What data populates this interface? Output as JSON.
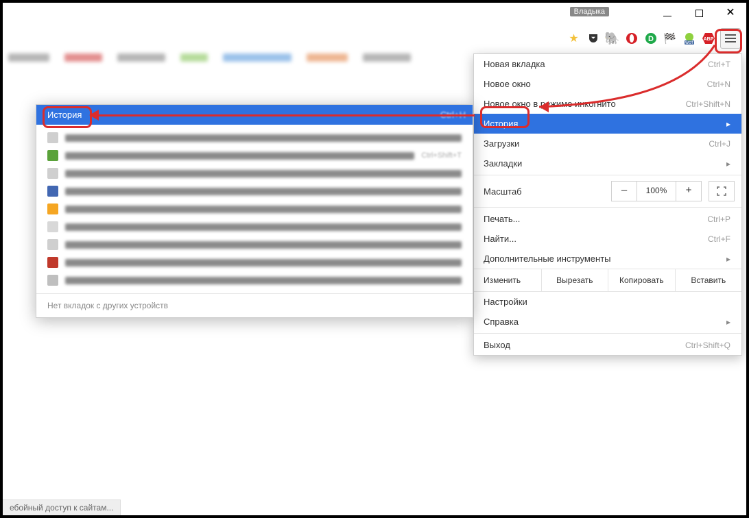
{
  "window": {
    "user_badge": "Владыка"
  },
  "menu": {
    "new_tab": {
      "label": "Новая вкладка",
      "shortcut": "Ctrl+T"
    },
    "new_window": {
      "label": "Новое окно",
      "shortcut": "Ctrl+N"
    },
    "incognito": {
      "label": "Новое окно в режиме инкогнито",
      "shortcut": "Ctrl+Shift+N"
    },
    "history": {
      "label": "История"
    },
    "downloads": {
      "label": "Загрузки",
      "shortcut": "Ctrl+J"
    },
    "bookmarks": {
      "label": "Закладки"
    },
    "zoom": {
      "label": "Масштаб",
      "value": "100%",
      "minus": "–",
      "plus": "+"
    },
    "print": {
      "label": "Печать...",
      "shortcut": "Ctrl+P"
    },
    "find": {
      "label": "Найти...",
      "shortcut": "Ctrl+F"
    },
    "more_tools": {
      "label": "Дополнительные инструменты"
    },
    "edit": {
      "label": "Изменить",
      "cut": "Вырезать",
      "copy": "Копировать",
      "paste": "Вставить"
    },
    "settings": {
      "label": "Настройки"
    },
    "help": {
      "label": "Справка"
    },
    "exit": {
      "label": "Выход",
      "shortcut": "Ctrl+Shift+Q"
    }
  },
  "submenu": {
    "title": "История",
    "shortcut": "Ctrl+H",
    "reopen_shortcut": "Ctrl+Shift+T",
    "footer": "Нет вкладок с других устройств",
    "items": [
      {
        "favicon": "#cfcfcf",
        "text_w": 170
      },
      {
        "favicon": "#5aa23a",
        "text_w": 290,
        "shortcut": true
      },
      {
        "favicon": "#cfcfcf",
        "text_w": 200
      },
      {
        "favicon": "#4267b2",
        "text_w": 190
      },
      {
        "favicon": "#f5a623",
        "text_w": 330
      },
      {
        "favicon": "#d8d8d8",
        "text_w": 100
      },
      {
        "favicon": "#cfcfcf",
        "text_w": 180
      },
      {
        "favicon": "#c0392b",
        "text_w": 440
      },
      {
        "favicon": "#bfbfbf",
        "text_w": 240
      }
    ]
  },
  "status_bar": "ебойный доступ к сайтам..."
}
